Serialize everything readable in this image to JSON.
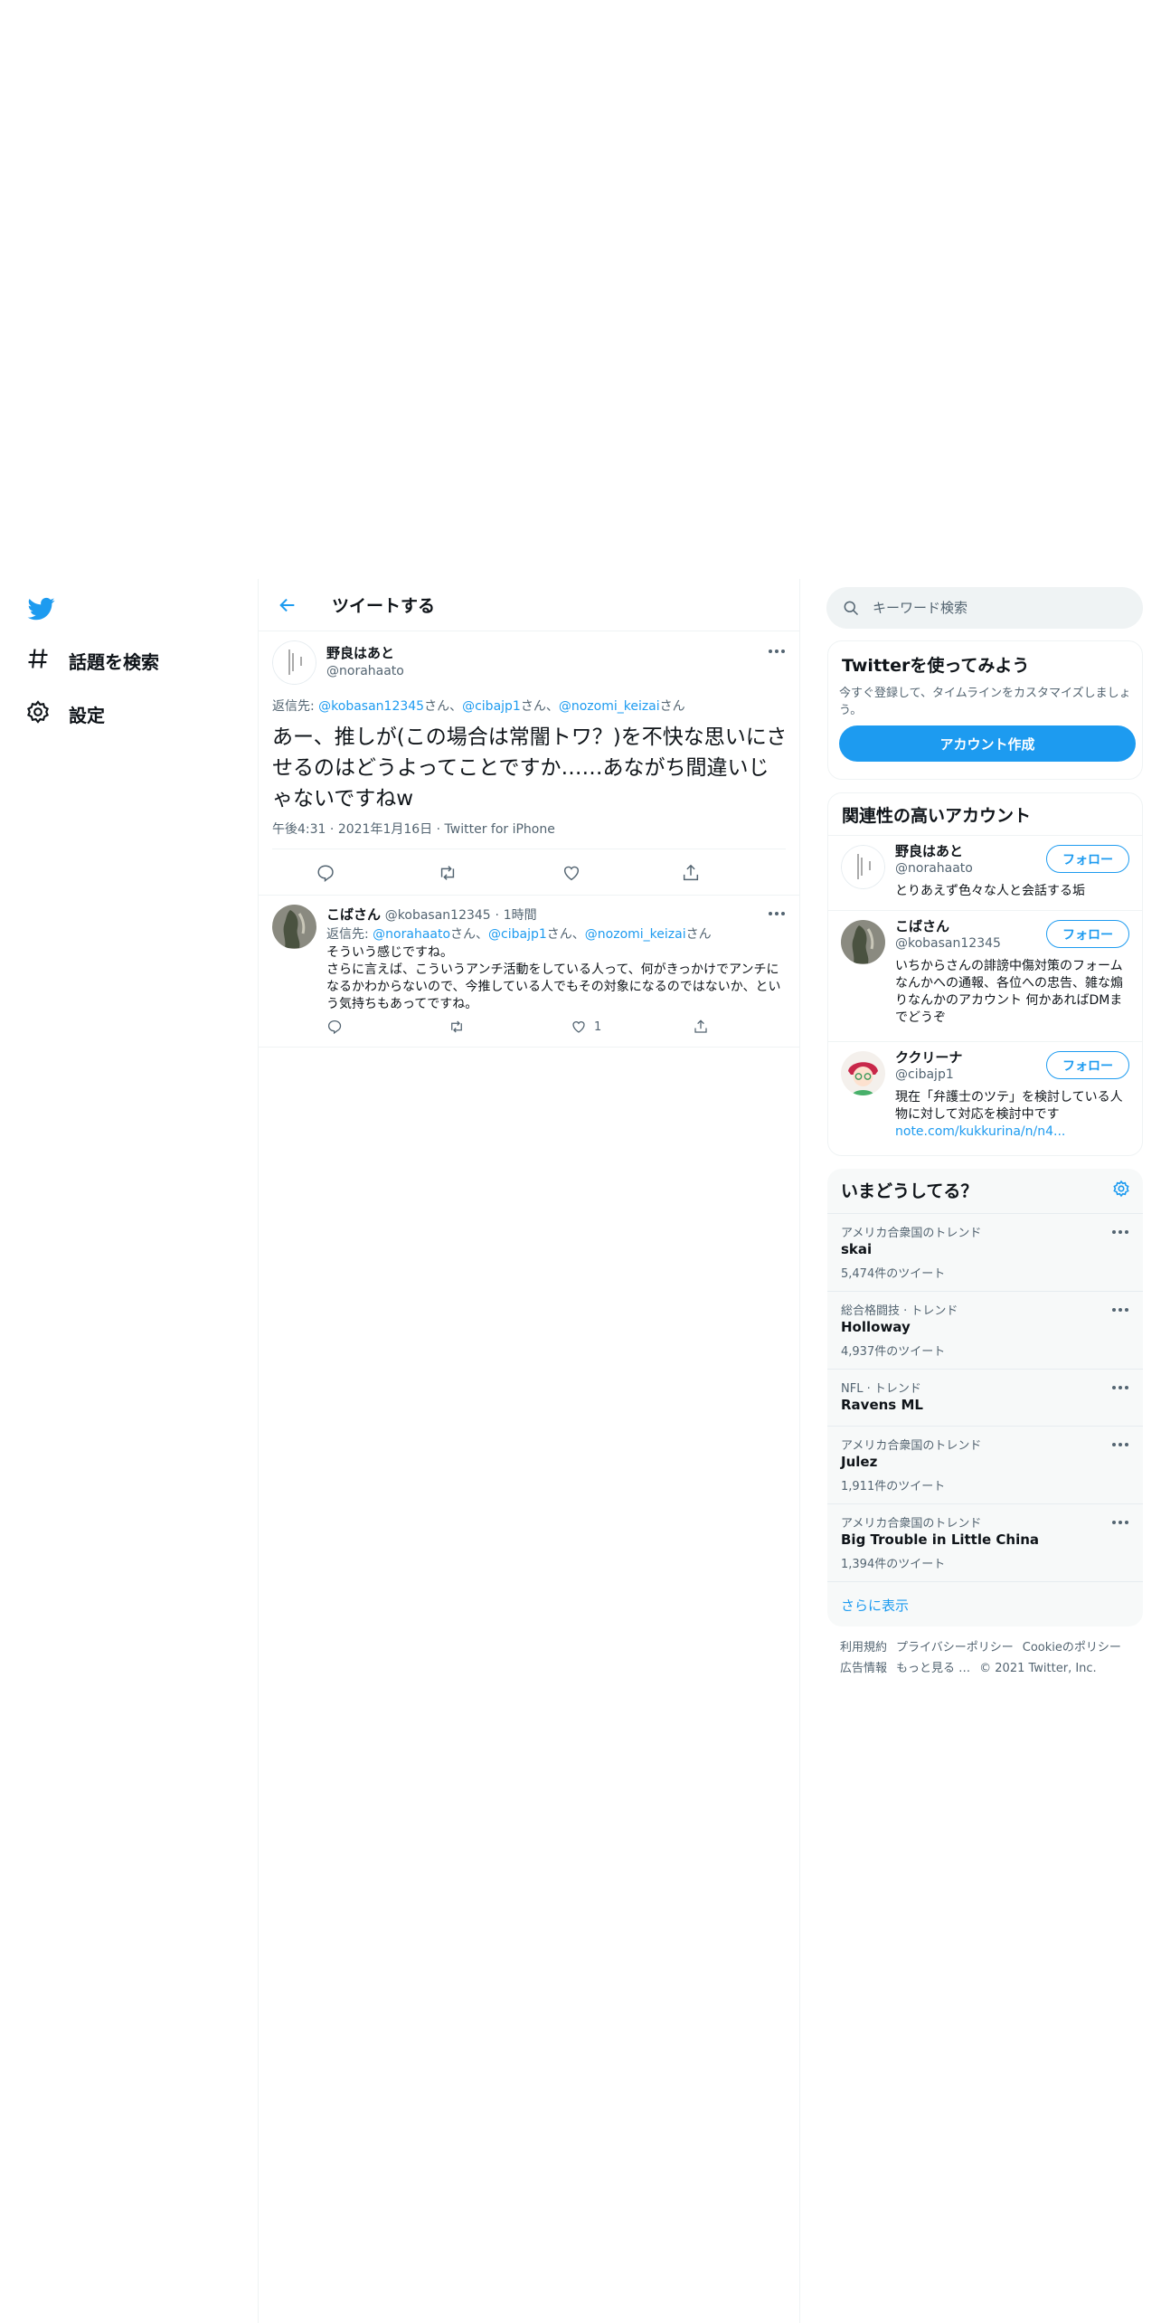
{
  "nav": {
    "explore_label": "話題を検索",
    "settings_label": "設定"
  },
  "header": {
    "title": "ツイートする"
  },
  "main_tweet": {
    "name": "野良はあと",
    "handle": "@norahaato",
    "reply_prefix": "返信先: ",
    "reply_to": [
      "@kobasan12345",
      "@cibajp1",
      "@nozomi_keizai"
    ],
    "reply_suffix": "さん",
    "reply_sep": "さん、",
    "text": "あー、推しが(この場合は常闇トワ？)を不快な思いにさせるのはどうよってことですか……あながち間違いじゃないですねw",
    "time": "午後4:31",
    "date": "2021年1月16日",
    "source": "Twitter for iPhone",
    "dot": "·"
  },
  "reply_tweet": {
    "name": "こばさん",
    "handle": "@kobasan12345",
    "dot": "·",
    "time": "1時間",
    "reply_prefix": "返信先: ",
    "reply_to": [
      "@norahaato",
      "@cibajp1",
      "@nozomi_keizai"
    ],
    "reply_sep": "さん、",
    "reply_suffix": "さん",
    "text": "そういう感じですね。\nさらに言えば、こういうアンチ活動をしている人って、何がきっかけでアンチになるかわからないので、今推している人でもその対象になるのではないか、という気持ちもあってですね。",
    "like_count": "1"
  },
  "search": {
    "placeholder": "キーワード検索"
  },
  "signup": {
    "title": "Twitterを使ってみよう",
    "desc": "今すぐ登録して、タイムラインをカスタマイズしましょう。",
    "button": "アカウント作成"
  },
  "who_to_follow": {
    "title": "関連性の高いアカウント",
    "follow_label": "フォロー",
    "accounts": [
      {
        "name": "野良はあと",
        "handle": "@norahaato",
        "bio": "とりあえず色々な人と会話する垢"
      },
      {
        "name": "こばさん",
        "handle": "@kobasan12345",
        "bio": "いちからさんの誹謗中傷対策のフォームなんかへの通報、各位への忠告、雑な煽りなんかのアカウント 何かあればDMまでどうぞ"
      },
      {
        "name": "ククリーナ",
        "handle": "@cibajp1",
        "bio": "現在「弁護士のツテ」を検討している人物に対して対応を検討中です",
        "link": "note.com/kukkurina/n/n4..."
      }
    ]
  },
  "trends": {
    "title": "いまどうしてる？",
    "items": [
      {
        "context": "アメリカ合衆国のトレンド",
        "name": "skai",
        "count": "5,474件のツイート"
      },
      {
        "context": "総合格闘技 · トレンド",
        "name": "Holloway",
        "count": "4,937件のツイート"
      },
      {
        "context": "NFL · トレンド",
        "name": "Ravens ML",
        "count": ""
      },
      {
        "context": "アメリカ合衆国のトレンド",
        "name": "Julez",
        "count": "1,911件のツイート"
      },
      {
        "context": "アメリカ合衆国のトレンド",
        "name": "Big Trouble in Little China",
        "count": "1,394件のツイート"
      }
    ],
    "show_more": "さらに表示"
  },
  "footer": {
    "links": [
      "利用規約",
      "プライバシーポリシー",
      "Cookieのポリシー",
      "広告情報",
      "もっと見る …"
    ],
    "copyright": "© 2021 Twitter, Inc."
  },
  "colors": {
    "accent": "#1d9bf0",
    "text": "#0f1419",
    "secondary": "#536471"
  }
}
